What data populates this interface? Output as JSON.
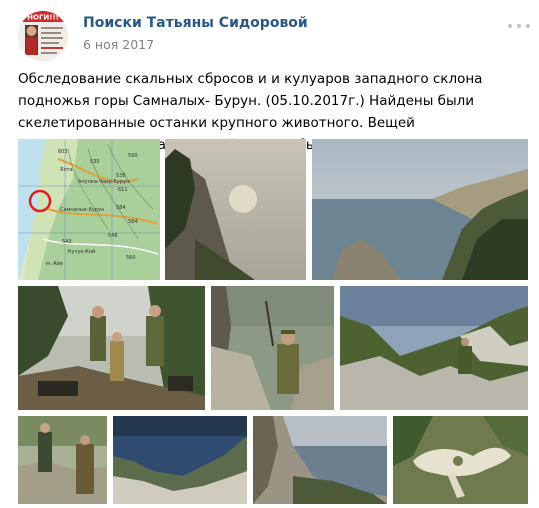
{
  "post": {
    "author": "Поиски Татьяны Сидоровой",
    "date": "6 ноя 2017",
    "text": "Обследование скальных сбросов и и кулуаров западного склона подножья горы Самналых- Бурун. (05.10.2017г.) Найдены были скелетированные останки крупного животного. Вещей принадлежавших Татьяне найдено не было.",
    "more_icon": "more-horizontal-icon"
  },
  "avatar": {
    "header_text": "НОГИ!!!",
    "lines": [
      "ПОМОГИТЕ НАЙТИ",
      "ТАТЬЯНА СИДОРОВА"
    ]
  },
  "map_labels": [
    "603",
    "535",
    "590",
    "538",
    "611",
    "Ялта",
    "Самналых-Бурун",
    "584",
    "543",
    "548",
    "560",
    "Кучук-Кой",
    "м. Айя",
    "584",
    "Алупка-Чаир-Бурун"
  ],
  "photos": [
    {
      "name": "photo-map",
      "kind": "map"
    },
    {
      "name": "photo-cliff-fog",
      "kind": "landscape"
    },
    {
      "name": "photo-coast-view",
      "kind": "landscape"
    },
    {
      "name": "photo-team-forest",
      "kind": "people"
    },
    {
      "name": "photo-searcher-rocks",
      "kind": "people"
    },
    {
      "name": "photo-rocky-slope",
      "kind": "landscape"
    },
    {
      "name": "photo-two-men",
      "kind": "people"
    },
    {
      "name": "photo-ridge-sky",
      "kind": "landscape"
    },
    {
      "name": "photo-cliff-edge",
      "kind": "landscape"
    },
    {
      "name": "photo-bones",
      "kind": "object"
    }
  ]
}
